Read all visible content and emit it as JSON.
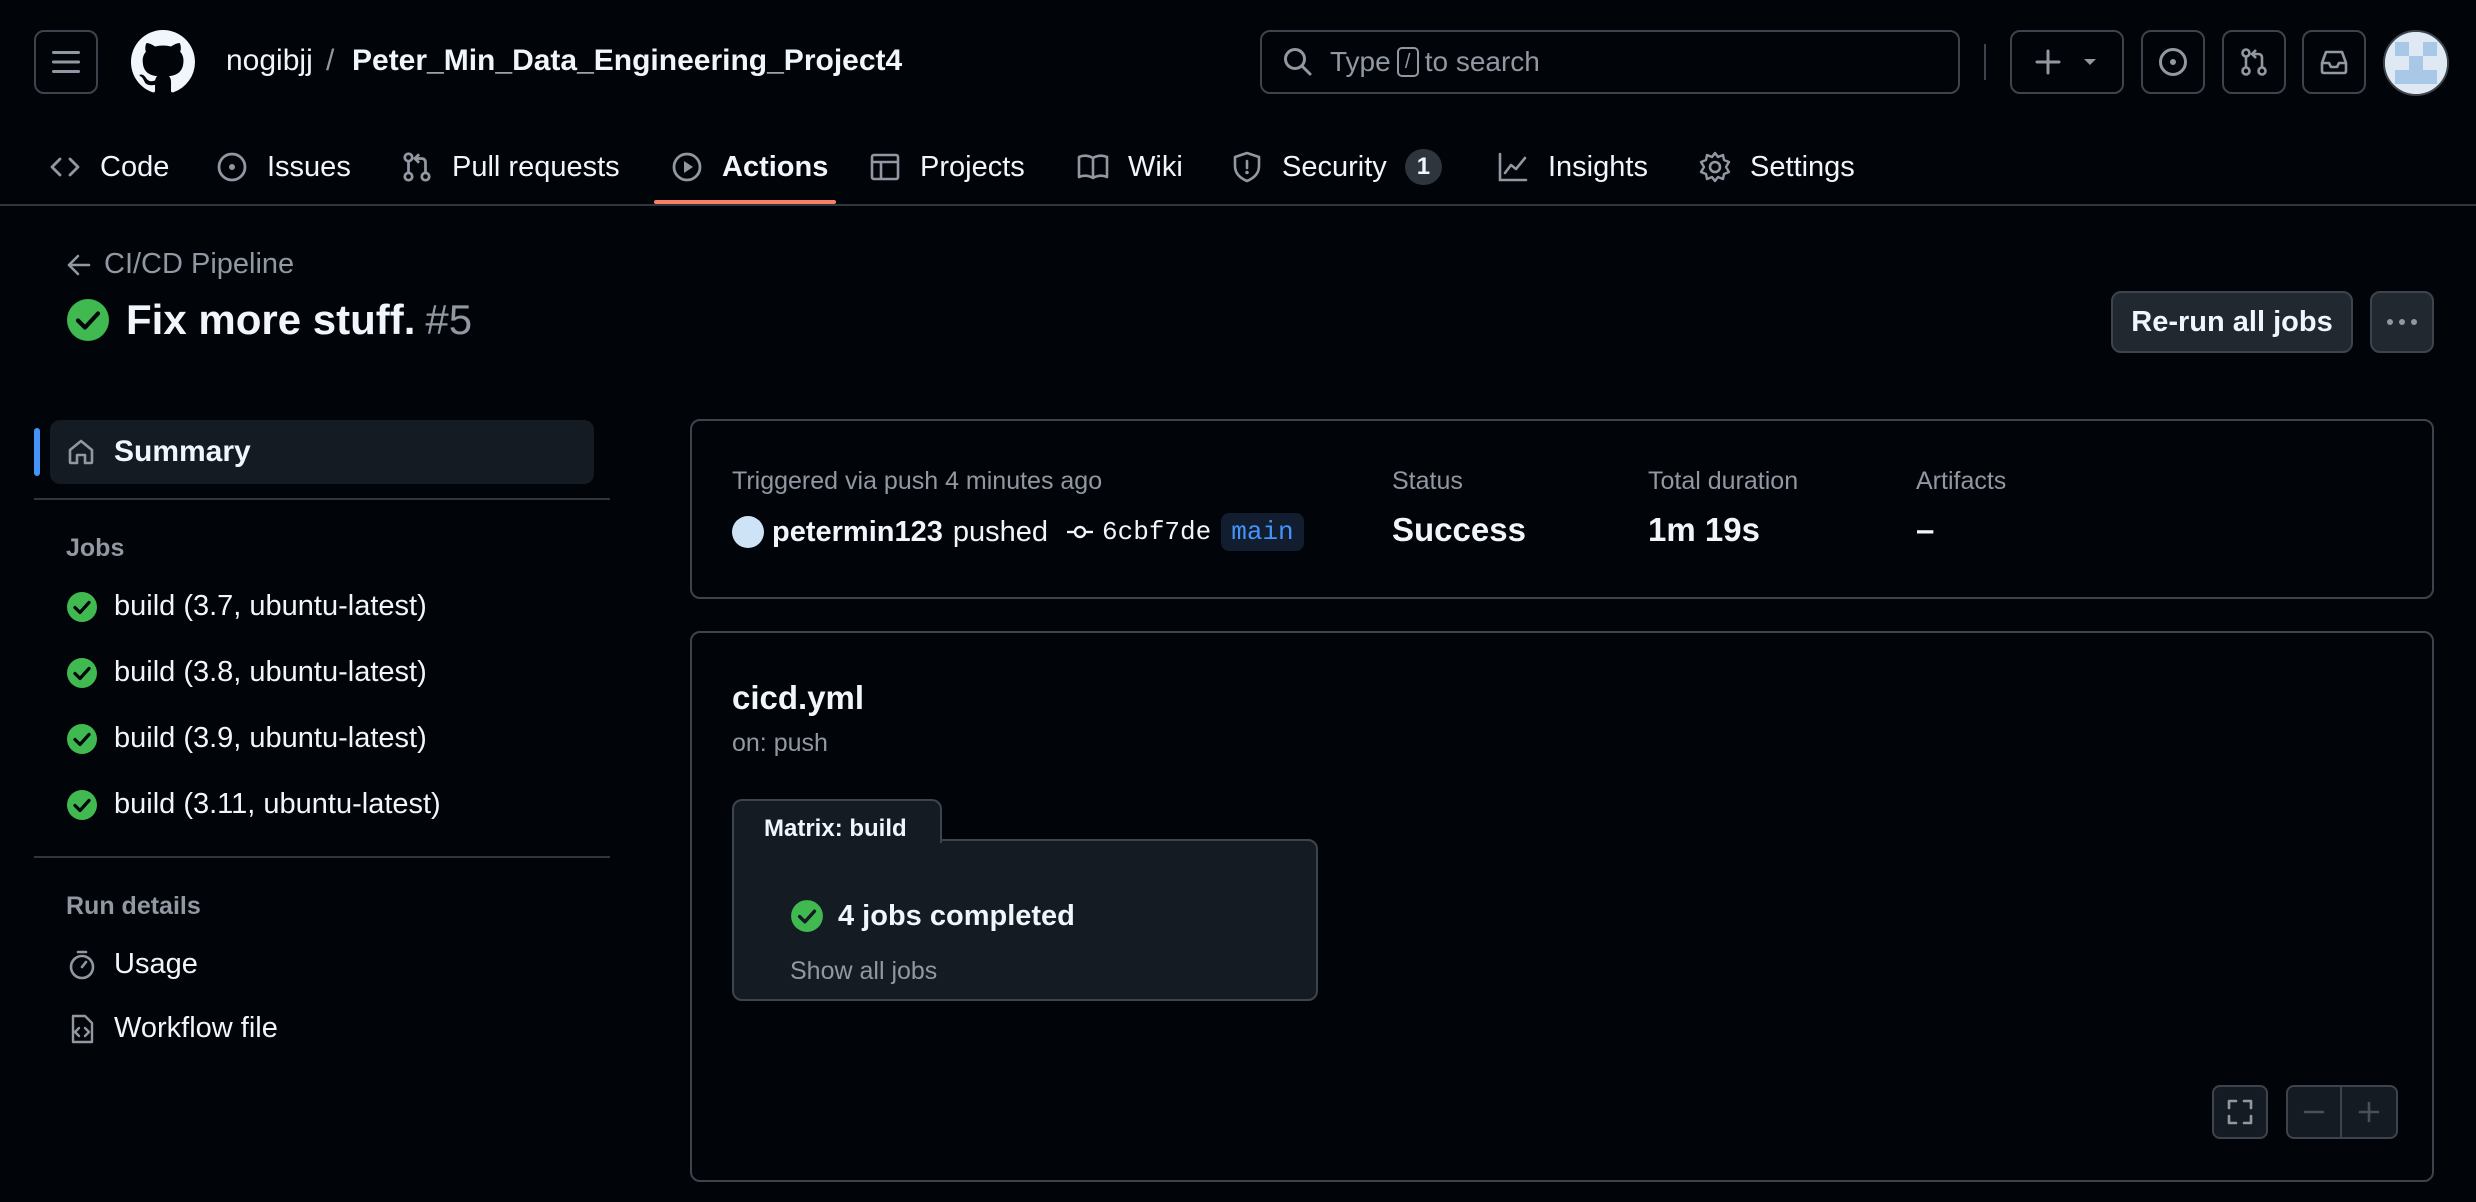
{
  "header": {
    "owner": "nogibjj",
    "separator": "/",
    "repo": "Peter_Min_Data_Engineering_Project4",
    "search": {
      "prefix": "Type",
      "key": "/",
      "suffix": "to search"
    }
  },
  "repo_nav": {
    "items": [
      {
        "label": "Code"
      },
      {
        "label": "Issues"
      },
      {
        "label": "Pull requests"
      },
      {
        "label": "Actions",
        "active": true
      },
      {
        "label": "Projects"
      },
      {
        "label": "Wiki"
      },
      {
        "label": "Security",
        "counter": "1"
      },
      {
        "label": "Insights"
      },
      {
        "label": "Settings"
      }
    ]
  },
  "run": {
    "back_label": "CI/CD Pipeline",
    "title": "Fix more stuff.",
    "number": "#5",
    "rerun_label": "Re-run all jobs"
  },
  "sidebar": {
    "summary_label": "Summary",
    "jobs_heading": "Jobs",
    "jobs": [
      "build (3.7, ubuntu-latest)",
      "build (3.8, ubuntu-latest)",
      "build (3.9, ubuntu-latest)",
      "build (3.11, ubuntu-latest)"
    ],
    "run_details_heading": "Run details",
    "usage_label": "Usage",
    "workflow_file_label": "Workflow file"
  },
  "summary": {
    "trigger_label": "Triggered via push 4 minutes ago",
    "pusher": "petermin123",
    "pushed_text": "pushed",
    "commit_sha": "6cbf7de",
    "branch": "main",
    "status_label": "Status",
    "status_value": "Success",
    "duration_label": "Total duration",
    "duration_value": "1m 19s",
    "artifacts_label": "Artifacts",
    "artifacts_value": "–"
  },
  "workflow": {
    "file_name": "cicd.yml",
    "trigger": "on: push",
    "matrix_label": "Matrix: build",
    "matrix_status": "4 jobs completed",
    "show_all_label": "Show all jobs"
  },
  "colors": {
    "background": "#010409",
    "success": "#3fb950",
    "accent_underline": "#f78166",
    "link_blue": "#4493f8"
  }
}
